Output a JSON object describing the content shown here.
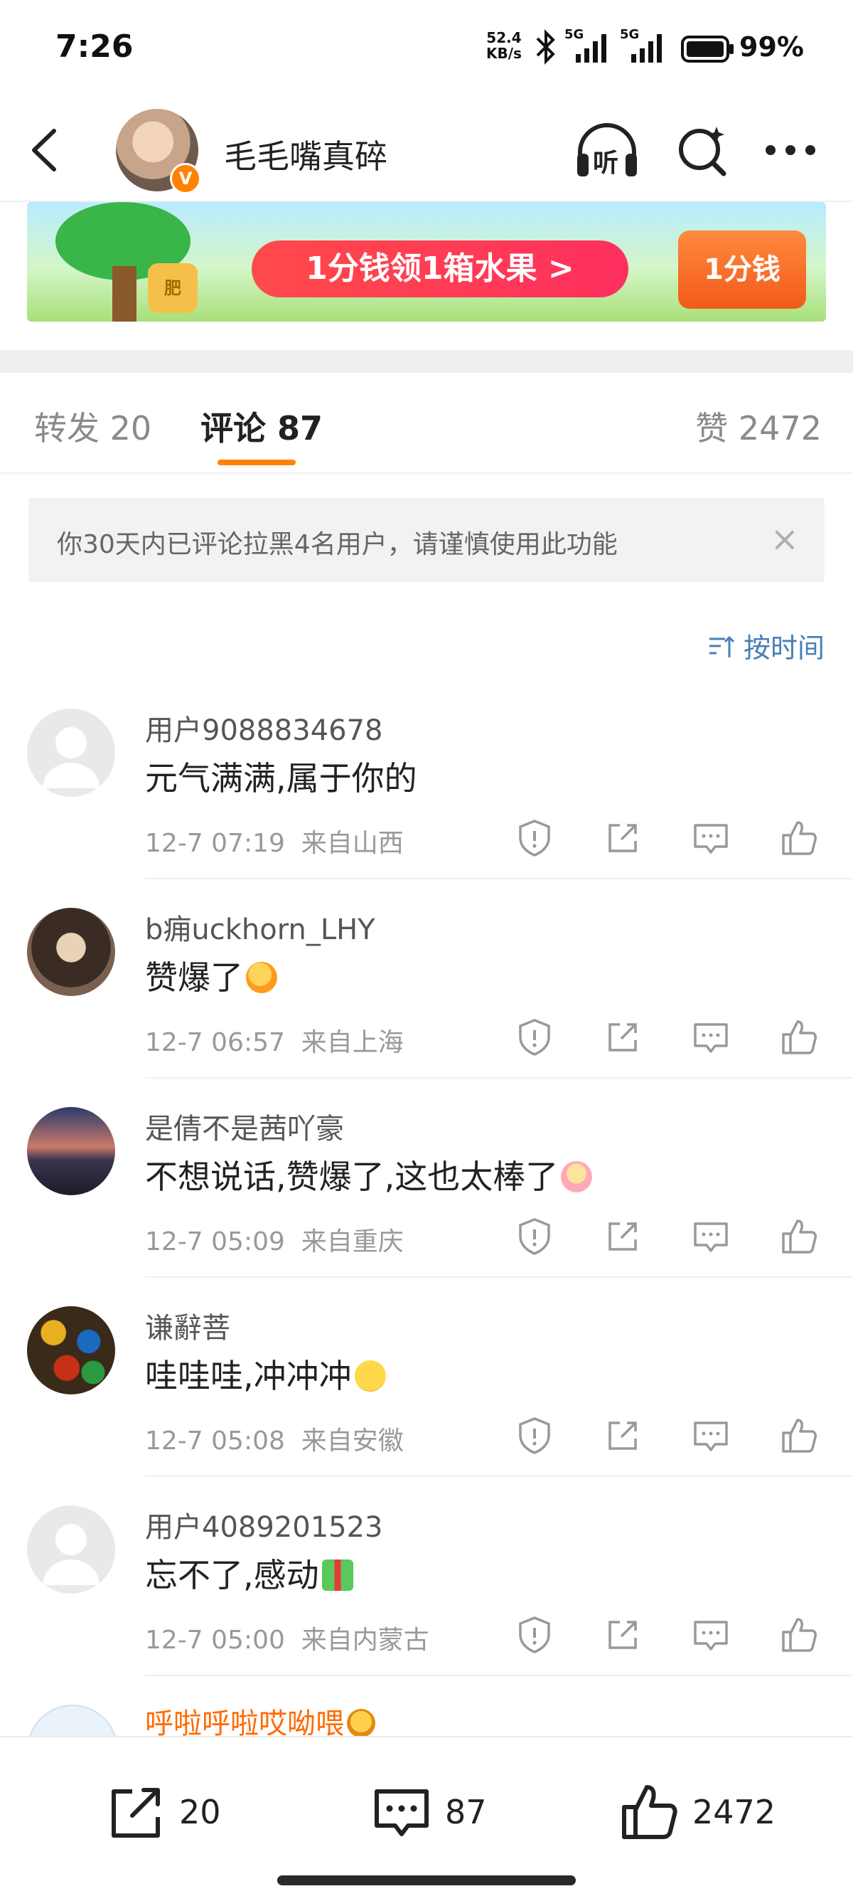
{
  "status_bar": {
    "time": "7:26",
    "net_speed_value": "52.4",
    "net_speed_unit": "KB/s",
    "network1": "5G",
    "network2": "5G",
    "battery": "99%"
  },
  "header": {
    "title": "毛毛嘴真碎",
    "back_icon": "back-arrow-icon",
    "listen_label": "听",
    "verified_badge": "V"
  },
  "banner": {
    "cta": "1分钱领1箱水果 >",
    "right_label": "1分钱",
    "bag_label": "肥"
  },
  "tabs": {
    "reposts": "转发 20",
    "comments": "评论 87",
    "likes": "赞 2472"
  },
  "notice": {
    "text": "你30天内已评论拉黑4名用户，请谨慎使用此功能",
    "close": "×"
  },
  "sort": {
    "label": "按时间"
  },
  "comments": [
    {
      "name": "用户9088834678",
      "text": "元气满满,属于你的",
      "time": "12-7 07:19",
      "location": "来自山西"
    },
    {
      "name": "b痈uckhorn_LHY",
      "text": "赞爆了",
      "time": "12-7 06:57",
      "location": "来自上海"
    },
    {
      "name": "是倩不是茜吖豪",
      "text": "不想说话,赞爆了,这也太棒了",
      "time": "12-7 05:09",
      "location": "来自重庆"
    },
    {
      "name": "谦辭菩",
      "text": "哇哇哇,冲冲冲",
      "time": "12-7 05:08",
      "location": "来自安徽"
    },
    {
      "name": "用户4089201523",
      "text": "忘不了,感动",
      "time": "12-7 05:00",
      "location": "来自内蒙古"
    },
    {
      "name": "呼啦呼啦哎呦喂"
    }
  ],
  "bottom_bar": {
    "reposts": "20",
    "comments": "87",
    "likes": "2472"
  },
  "colors": {
    "accent": "#ff8200",
    "link_blue": "#4a7fb5",
    "vip_name": "#ff6a00"
  }
}
